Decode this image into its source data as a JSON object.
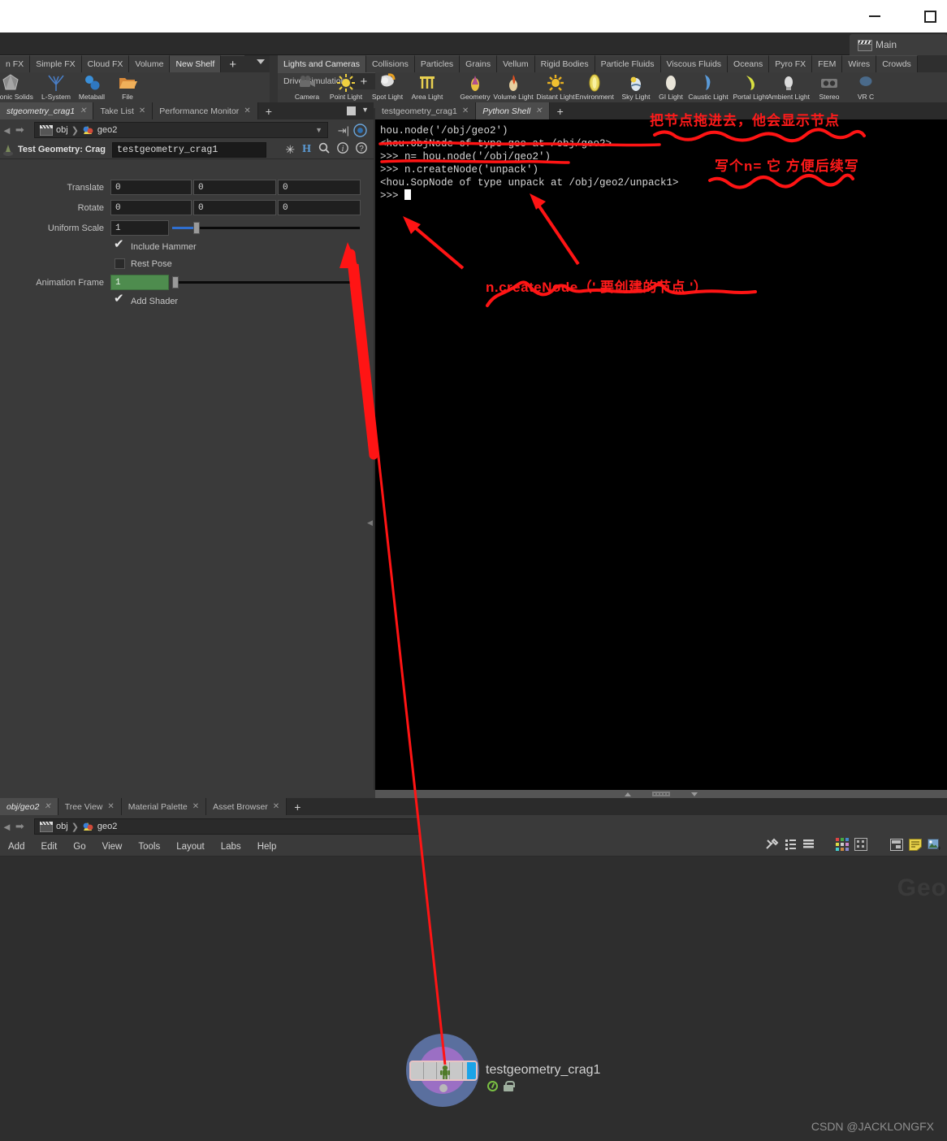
{
  "window": {
    "minimize_label": "minimize",
    "maximize_label": "maximize"
  },
  "desktop": {
    "tab_label": "Main"
  },
  "shelf_left": {
    "tabs": [
      "n FX",
      "Simple FX",
      "Cloud FX",
      "Volume",
      "New Shelf",
      "+"
    ],
    "tools": [
      {
        "label": "Platonic Solids",
        "icon": "platonic-solids-icon"
      },
      {
        "label": "L-System",
        "icon": "l-system-icon"
      },
      {
        "label": "Metaball",
        "icon": "metaball-icon"
      },
      {
        "label": "File",
        "icon": "file-icon"
      }
    ]
  },
  "shelf_right": {
    "tabs": [
      "Lights and Cameras",
      "Collisions",
      "Particles",
      "Grains",
      "Vellum",
      "Rigid Bodies",
      "Particle Fluids",
      "Viscous Fluids",
      "Oceans",
      "Pyro FX",
      "FEM",
      "Wires",
      "Crowds",
      "Drive Simulation",
      "+"
    ],
    "tools": [
      {
        "label": "Camera",
        "icon": "camera-icon"
      },
      {
        "label": "Point Light",
        "icon": "point-light-icon"
      },
      {
        "label": "Spot Light",
        "icon": "spot-light-icon"
      },
      {
        "label": "Area Light",
        "icon": "area-light-icon"
      },
      {
        "label": "Geometry Light",
        "icon": "geometry-light-icon"
      },
      {
        "label": "Volume Light",
        "icon": "volume-light-icon"
      },
      {
        "label": "Distant Light",
        "icon": "distant-light-icon"
      },
      {
        "label": "Environment Light",
        "icon": "environment-light-icon"
      },
      {
        "label": "Sky Light",
        "icon": "sky-light-icon"
      },
      {
        "label": "GI Light",
        "icon": "gi-light-icon"
      },
      {
        "label": "Caustic Light",
        "icon": "caustic-light-icon"
      },
      {
        "label": "Portal Light",
        "icon": "portal-light-icon"
      },
      {
        "label": "Ambient Light",
        "icon": "ambient-light-icon"
      },
      {
        "label": "Stereo Camera",
        "icon": "stereo-camera-icon"
      },
      {
        "label": "VR C",
        "icon": "vr-camera-icon"
      }
    ]
  },
  "left_pane": {
    "tabs": [
      {
        "label": "stgeometry_crag1",
        "active": true
      },
      {
        "label": "Take List",
        "active": false
      },
      {
        "label": "Performance Monitor",
        "active": false
      }
    ],
    "add_tab": "+",
    "breadcrumb": {
      "root": "obj",
      "node": "geo2"
    },
    "parameters": {
      "title": "Test Geometry: Crag",
      "node_name": "testgeometry_crag1",
      "rows": [
        {
          "label": "Translate",
          "values": [
            "0",
            "0",
            "0"
          ]
        },
        {
          "label": "Rotate",
          "values": [
            "0",
            "0",
            "0"
          ]
        }
      ],
      "uniform_scale": {
        "label": "Uniform Scale",
        "value": "1"
      },
      "include_hammer": {
        "label": "Include Hammer",
        "checked": true
      },
      "rest_pose": {
        "label": "Rest Pose",
        "checked": false
      },
      "animation_frame": {
        "label": "Animation Frame",
        "value": "1"
      },
      "add_shader": {
        "label": "Add Shader",
        "checked": true
      }
    }
  },
  "right_pane": {
    "tabs": [
      {
        "label": "testgeometry_crag1",
        "active": false
      },
      {
        "label": "Python Shell",
        "active": true
      }
    ],
    "add_tab": "+",
    "shell_lines": [
      "hou.node('/obj/geo2')",
      "<hou.ObjNode of type geo at /obj/geo2>",
      ">>> n= hou.node('/obj/geo2')",
      ">>> n.createNode('unpack')",
      "<hou.SopNode of type unpack at /obj/geo2/unpack1>"
    ],
    "prompt": ">>> "
  },
  "network_pane": {
    "tabs": [
      {
        "label": "obj/geo2",
        "active": true
      },
      {
        "label": "Tree View",
        "active": false
      },
      {
        "label": "Material Palette",
        "active": false
      },
      {
        "label": "Asset Browser",
        "active": false
      }
    ],
    "add_tab": "+",
    "breadcrumb": {
      "root": "obj",
      "node": "geo2"
    },
    "menu": [
      "Add",
      "Edit",
      "Go",
      "View",
      "Tools",
      "Layout",
      "Labs",
      "Help"
    ],
    "toolbar_icons": [
      "tools-icon",
      "list-tree-icon",
      "layers-icon",
      "color-grid-icon",
      "snapshot-grid-icon",
      "panel-icon",
      "note-icon",
      "add-image-icon"
    ],
    "watermark": "Geo",
    "node": {
      "name": "testgeometry_crag1",
      "glyph": "crag-figure-icon",
      "badges": [
        "display-flag-icon",
        "lock-icon"
      ]
    }
  },
  "annotations": {
    "note1": "把节点拖进去，他会显示节点",
    "note2": "写个n= 它 方便后续写",
    "note3": "n.createNode（' 要创建的节点 '）",
    "color": "#ff1a1a"
  },
  "footer": {
    "credit": "CSDN @JACKLONGFX"
  }
}
